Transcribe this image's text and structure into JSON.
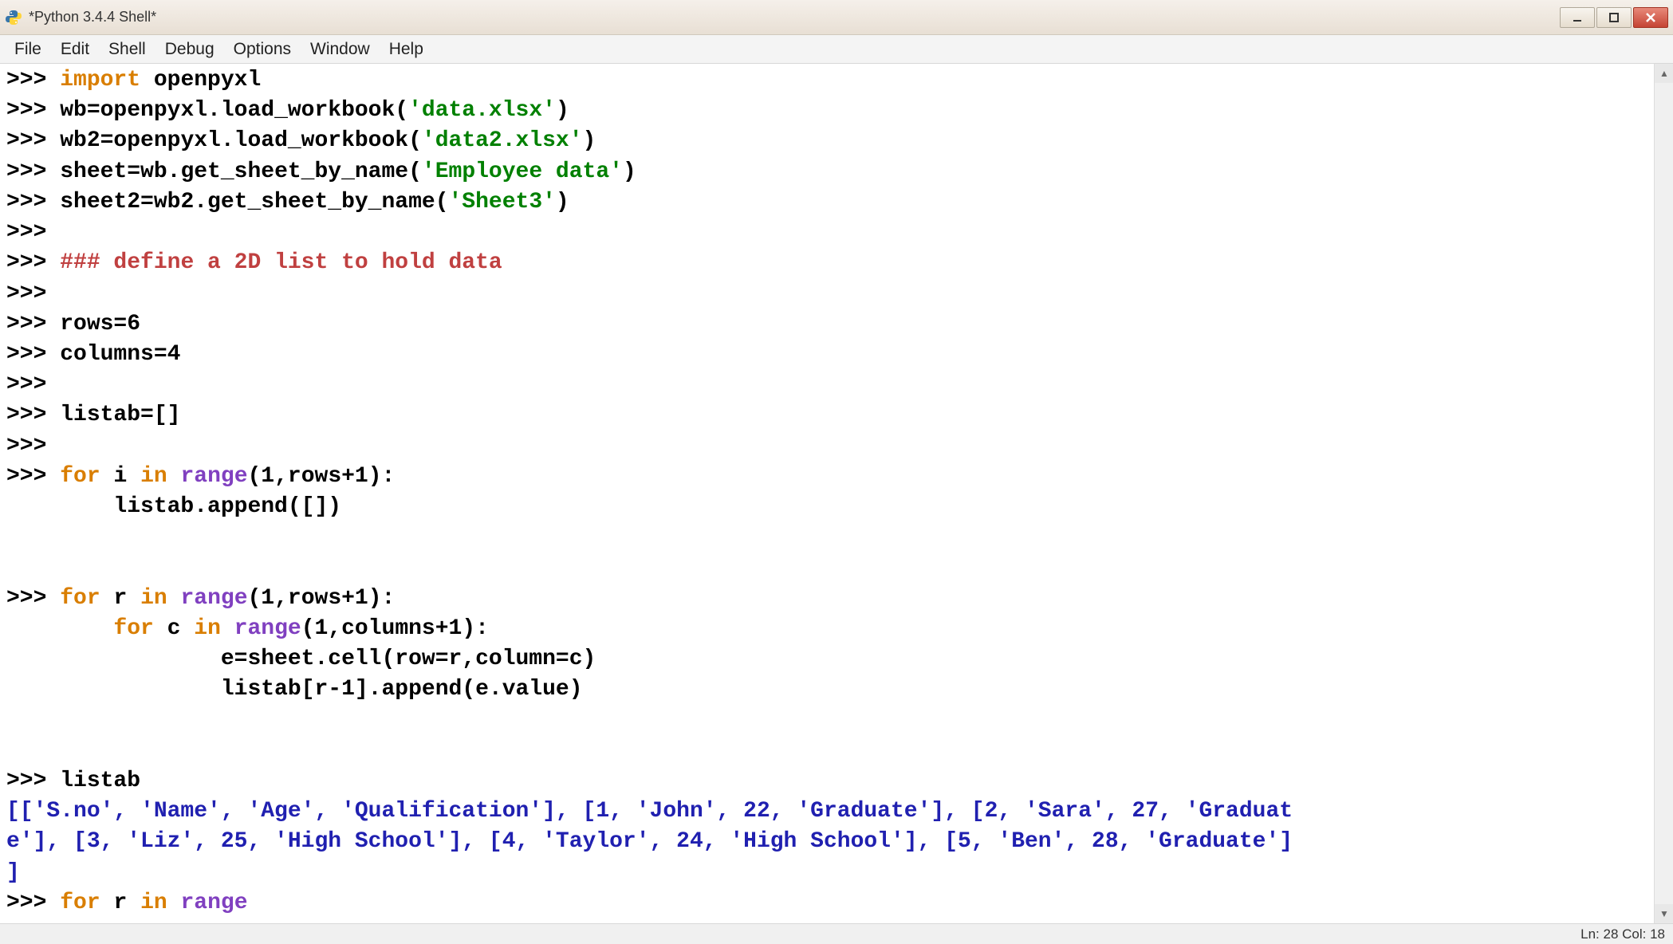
{
  "titlebar": {
    "title": "*Python 3.4.4 Shell*"
  },
  "menubar": {
    "items": [
      "File",
      "Edit",
      "Shell",
      "Debug",
      "Options",
      "Window",
      "Help"
    ]
  },
  "code": {
    "prompt": ">>> ",
    "l1_import": "import",
    "l1_rest": " openpyxl",
    "l2_pre": "wb=openpyxl.load_workbook(",
    "l2_str": "'data.xlsx'",
    "l2_post": ")",
    "l3_pre": "wb2=openpyxl.load_workbook(",
    "l3_str": "'data2.xlsx'",
    "l3_post": ")",
    "l4_pre": "sheet=wb.get_sheet_by_name(",
    "l4_str": "'Employee data'",
    "l4_post": ")",
    "l5_pre": "sheet2=wb2.get_sheet_by_name(",
    "l5_str": "'Sheet3'",
    "l5_post": ")",
    "l7_comment": "### define a 2D list to hold data",
    "l9": "rows=6",
    "l10": "columns=4",
    "l12": "listab=[]",
    "l14_for": "for",
    "l14_mid": " i ",
    "l14_in": "in",
    "l14_sp": " ",
    "l14_range": "range",
    "l14_rest": "(1,rows+1):",
    "l15": "        listab.append([])",
    "l17_for": "for",
    "l17_mid": " r ",
    "l17_in": "in",
    "l17_sp": " ",
    "l17_range": "range",
    "l17_rest": "(1,rows+1):",
    "l18_indent": "        ",
    "l18_for": "for",
    "l18_mid": " c ",
    "l18_in": "in",
    "l18_sp": " ",
    "l18_range": "range",
    "l18_rest": "(1,columns+1):",
    "l19": "                e=sheet.cell(row=r,column=c)",
    "l20": "                listab[r-1].append(e.value)",
    "l22": "listab",
    "l23_out": "[['S.no', 'Name', 'Age', 'Qualification'], [1, 'John', 22, 'Graduate'], [2, 'Sara', 27, 'Graduate'], [3, 'Liz', 25, 'High School'], [4, 'Taylor', 24, 'High School'], [5, 'Ben', 28, 'Graduate']]",
    "l24_for": "for",
    "l24_mid": " r ",
    "l24_in": "in",
    "l24_sp": " ",
    "l24_range": "range"
  },
  "statusbar": {
    "pos": "Ln: 28 Col: 18"
  }
}
